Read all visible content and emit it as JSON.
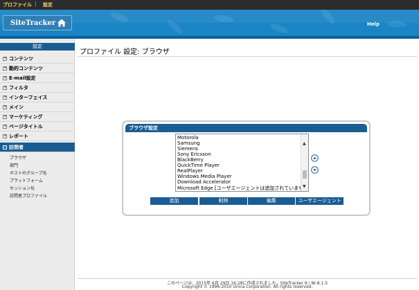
{
  "topnav": {
    "item1": "プロファイル",
    "sep": "|",
    "item2": "設定"
  },
  "header": {
    "logo_text": "SiteTracker",
    "help": "Help"
  },
  "sidebar": {
    "title": "設定",
    "items": [
      {
        "label": "コンテンツ",
        "marker": "+"
      },
      {
        "label": "動的コンテンツ",
        "marker": "+"
      },
      {
        "label": "E-mail設定",
        "marker": "+"
      },
      {
        "label": "フィルタ",
        "marker": "+"
      },
      {
        "label": "インターフェイス",
        "marker": "+"
      },
      {
        "label": "メイン",
        "marker": "+"
      },
      {
        "label": "マーケティング",
        "marker": "+"
      },
      {
        "label": "ページタイトル",
        "marker": "+"
      },
      {
        "label": "レポート",
        "marker": "+"
      },
      {
        "label": "訪問者",
        "marker": "−"
      }
    ],
    "subitems": [
      "ブラウザ",
      "部門",
      "ホストのグループ化",
      "プラットフォーム",
      "セッション化",
      "訪問者プロファイル"
    ]
  },
  "main": {
    "title": "プロファイル 設定: ブラウザ"
  },
  "panel": {
    "title": "ブラウザ設定",
    "list": [
      "Motorola",
      "Samsung",
      "Siemens",
      "Sony Ericsson",
      "BlackBerry",
      "QuickTime Player",
      "RealPlayer",
      "Windows Media Player",
      "Download Accelerator",
      "Microsoft Edge [ユーザエージェントは追加されていません]"
    ],
    "buttons": {
      "add": "追加",
      "delete": "削除",
      "edit": "編集",
      "useragent": "ユーザエージェント"
    }
  },
  "footer": {
    "line1": "このページは、2015年 6月 29日 16:28に作成されました。SiteTracker 9 / NI-8.1.5",
    "line2": "Copyright © 1996-2010 Unica Corporation. All rights reserved."
  },
  "colors": {
    "header": "#1a84c5",
    "nav_dark": "#1a5d93",
    "topnav": "#2b2b2b",
    "topnav_text": "#f6d36b"
  },
  "icons": {
    "home": "home-icon",
    "up": "arrow-up-circle-icon",
    "down": "arrow-down-circle-icon"
  }
}
